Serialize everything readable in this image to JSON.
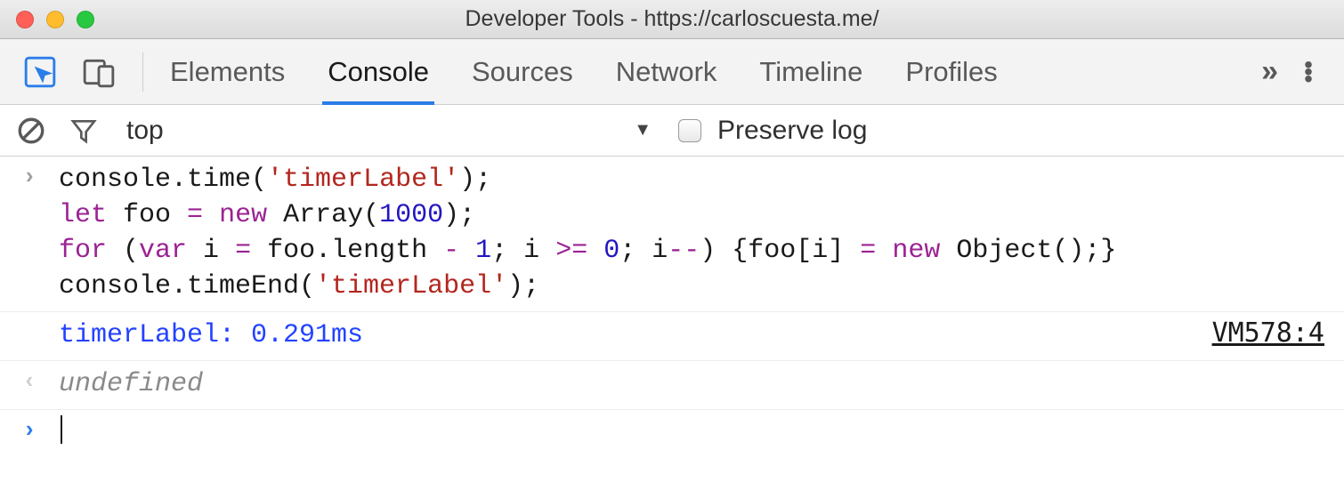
{
  "window": {
    "title": "Developer Tools - https://carloscuesta.me/"
  },
  "tabs": {
    "items": [
      "Elements",
      "Console",
      "Sources",
      "Network",
      "Timeline",
      "Profiles"
    ],
    "activeIndex": 1,
    "overflow": "»"
  },
  "toolbar": {
    "context": "top",
    "preserve_label": "Preserve log",
    "preserve_checked": false
  },
  "console": {
    "input": {
      "l1a": "console.time(",
      "l1s": "'timerLabel'",
      "l1b": ");",
      "l2a": "let",
      "l2b": " foo ",
      "l2c": "=",
      "l2d": " ",
      "l2e": "new",
      "l2f": " Array(",
      "l2n": "1000",
      "l2g": ");",
      "l3a": "for",
      "l3b": " (",
      "l3c": "var",
      "l3d": " i ",
      "l3e": "=",
      "l3f": " foo.length ",
      "l3g": "-",
      "l3h": " ",
      "l3n1": "1",
      "l3i": "; i ",
      "l3j": ">=",
      "l3k": " ",
      "l3n2": "0",
      "l3l": "; i",
      "l3m": "--",
      "l3n": ") {foo[i] ",
      "l3o": "=",
      "l3p": " ",
      "l3q": "new",
      "l3r": " Object();}",
      "l4a": "console.timeEnd(",
      "l4s": "'timerLabel'",
      "l4b": ");"
    },
    "log": {
      "text": "timerLabel: 0.291ms",
      "source": "VM578:4"
    },
    "ret": "undefined"
  }
}
